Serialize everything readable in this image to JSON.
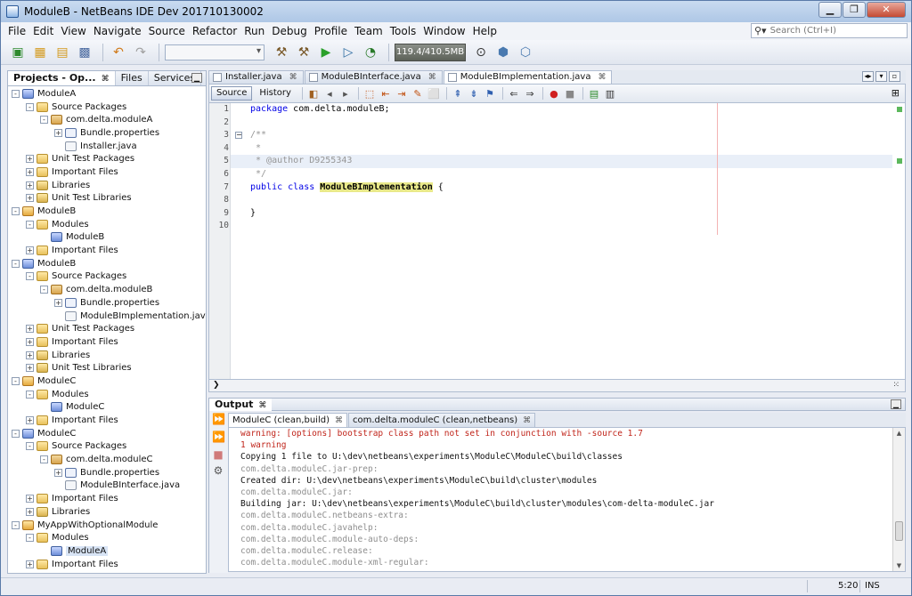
{
  "window": {
    "title": "ModuleB - NetBeans IDE Dev 201710130002"
  },
  "menu": [
    "File",
    "Edit",
    "View",
    "Navigate",
    "Source",
    "Refactor",
    "Run",
    "Debug",
    "Profile",
    "Team",
    "Tools",
    "Window",
    "Help"
  ],
  "search": {
    "placeholder": "Search (Ctrl+I)"
  },
  "toolbar": {
    "memory": "119.4/410.5MB"
  },
  "projects_panel": {
    "tabs": [
      "Projects - Op...",
      "Files",
      "Services"
    ],
    "tree": [
      {
        "label": "ModuleA",
        "depth": 0,
        "icon": "module",
        "exp": "-"
      },
      {
        "label": "Source Packages",
        "depth": 1,
        "icon": "folder",
        "exp": "-"
      },
      {
        "label": "com.delta.moduleA",
        "depth": 2,
        "icon": "pkg",
        "exp": "-"
      },
      {
        "label": "Bundle.properties",
        "depth": 3,
        "icon": "props",
        "exp": "+"
      },
      {
        "label": "Installer.java",
        "depth": 3,
        "icon": "java",
        "exp": ""
      },
      {
        "label": "Unit Test Packages",
        "depth": 1,
        "icon": "folder",
        "exp": "+"
      },
      {
        "label": "Important Files",
        "depth": 1,
        "icon": "folder",
        "exp": "+"
      },
      {
        "label": "Libraries",
        "depth": 1,
        "icon": "lib",
        "exp": "+"
      },
      {
        "label": "Unit Test Libraries",
        "depth": 1,
        "icon": "lib",
        "exp": "+"
      },
      {
        "label": "ModuleB",
        "depth": 0,
        "icon": "suite",
        "exp": "-"
      },
      {
        "label": "Modules",
        "depth": 1,
        "icon": "folder",
        "exp": "-"
      },
      {
        "label": "ModuleB",
        "depth": 2,
        "icon": "module",
        "exp": ""
      },
      {
        "label": "Important Files",
        "depth": 1,
        "icon": "folder",
        "exp": "+"
      },
      {
        "label": "ModuleB",
        "depth": 0,
        "icon": "module",
        "exp": "-"
      },
      {
        "label": "Source Packages",
        "depth": 1,
        "icon": "folder",
        "exp": "-"
      },
      {
        "label": "com.delta.moduleB",
        "depth": 2,
        "icon": "pkg",
        "exp": "-"
      },
      {
        "label": "Bundle.properties",
        "depth": 3,
        "icon": "props",
        "exp": "+"
      },
      {
        "label": "ModuleBImplementation.java",
        "depth": 3,
        "icon": "java",
        "exp": ""
      },
      {
        "label": "Unit Test Packages",
        "depth": 1,
        "icon": "folder",
        "exp": "+"
      },
      {
        "label": "Important Files",
        "depth": 1,
        "icon": "folder",
        "exp": "+"
      },
      {
        "label": "Libraries",
        "depth": 1,
        "icon": "lib",
        "exp": "+"
      },
      {
        "label": "Unit Test Libraries",
        "depth": 1,
        "icon": "lib",
        "exp": "+"
      },
      {
        "label": "ModuleC",
        "depth": 0,
        "icon": "suite",
        "exp": "-"
      },
      {
        "label": "Modules",
        "depth": 1,
        "icon": "folder",
        "exp": "-"
      },
      {
        "label": "ModuleC",
        "depth": 2,
        "icon": "module",
        "exp": ""
      },
      {
        "label": "Important Files",
        "depth": 1,
        "icon": "folder",
        "exp": "+"
      },
      {
        "label": "ModuleC",
        "depth": 0,
        "icon": "module",
        "exp": "-"
      },
      {
        "label": "Source Packages",
        "depth": 1,
        "icon": "folder",
        "exp": "-"
      },
      {
        "label": "com.delta.moduleC",
        "depth": 2,
        "icon": "pkg",
        "exp": "-"
      },
      {
        "label": "Bundle.properties",
        "depth": 3,
        "icon": "props",
        "exp": "+"
      },
      {
        "label": "ModuleBInterface.java",
        "depth": 3,
        "icon": "java",
        "exp": ""
      },
      {
        "label": "Important Files",
        "depth": 1,
        "icon": "folder",
        "exp": "+"
      },
      {
        "label": "Libraries",
        "depth": 1,
        "icon": "lib",
        "exp": "+"
      },
      {
        "label": "MyAppWithOptionalModule",
        "depth": 0,
        "icon": "suite",
        "exp": "-"
      },
      {
        "label": "Modules",
        "depth": 1,
        "icon": "folder",
        "exp": "-"
      },
      {
        "label": "ModuleA",
        "depth": 2,
        "icon": "module",
        "exp": "",
        "selected": true
      },
      {
        "label": "Important Files",
        "depth": 1,
        "icon": "folder",
        "exp": "+"
      }
    ]
  },
  "editor": {
    "tabs": [
      {
        "label": "Installer.java",
        "active": false
      },
      {
        "label": "ModuleBInterface.java",
        "active": false
      },
      {
        "label": "ModuleBImplementation.java",
        "active": true
      }
    ],
    "source_label": "Source",
    "history_label": "History",
    "lines": [
      {
        "n": "1",
        "html": "<span class='kw'>package</span> com.delta.moduleB;"
      },
      {
        "n": "2",
        "html": ""
      },
      {
        "n": "3",
        "html": "<span class='cm'>/**</span>"
      },
      {
        "n": "4",
        "html": "<span class='cm'> *</span>"
      },
      {
        "n": "5",
        "html": "<span class='cm'> * @author D9255343</span>"
      },
      {
        "n": "6",
        "html": "<span class='cm'> */</span>"
      },
      {
        "n": "7",
        "html": "<span class='kw'>public class</span> <span class='cls'>ModuleBImplementation</span> {"
      },
      {
        "n": "8",
        "html": ""
      },
      {
        "n": "9",
        "html": "}"
      },
      {
        "n": "10",
        "html": ""
      }
    ]
  },
  "output": {
    "title": "Output",
    "tabs": [
      {
        "label": "ModuleC (clean,build)",
        "active": true
      },
      {
        "label": "com.delta.moduleC (clean,netbeans)",
        "active": false
      }
    ],
    "lines": [
      {
        "text": "warning: [options] bootstrap class path not set in conjunction with -source 1.7",
        "style": "red"
      },
      {
        "text": "1 warning",
        "style": "red"
      },
      {
        "text": "Copying 1 file to U:\\dev\\netbeans\\experiments\\ModuleC\\ModuleC\\build\\classes",
        "style": "black"
      },
      {
        "text": "com.delta.moduleC.jar-prep:",
        "style": "gray"
      },
      {
        "text": "Created dir: U:\\dev\\netbeans\\experiments\\ModuleC\\build\\cluster\\modules",
        "style": "black"
      },
      {
        "text": "com.delta.moduleC.jar:",
        "style": "gray"
      },
      {
        "text": "Building jar: U:\\dev\\netbeans\\experiments\\ModuleC\\build\\cluster\\modules\\com-delta-moduleC.jar",
        "style": "black"
      },
      {
        "text": "com.delta.moduleC.netbeans-extra:",
        "style": "gray"
      },
      {
        "text": "com.delta.moduleC.javahelp:",
        "style": "gray"
      },
      {
        "text": "com.delta.moduleC.module-auto-deps:",
        "style": "gray"
      },
      {
        "text": "com.delta.moduleC.release:",
        "style": "gray"
      },
      {
        "text": "com.delta.moduleC.module-xml-regular:",
        "style": "gray"
      }
    ]
  },
  "status": {
    "position": "5:20",
    "mode": "INS"
  }
}
